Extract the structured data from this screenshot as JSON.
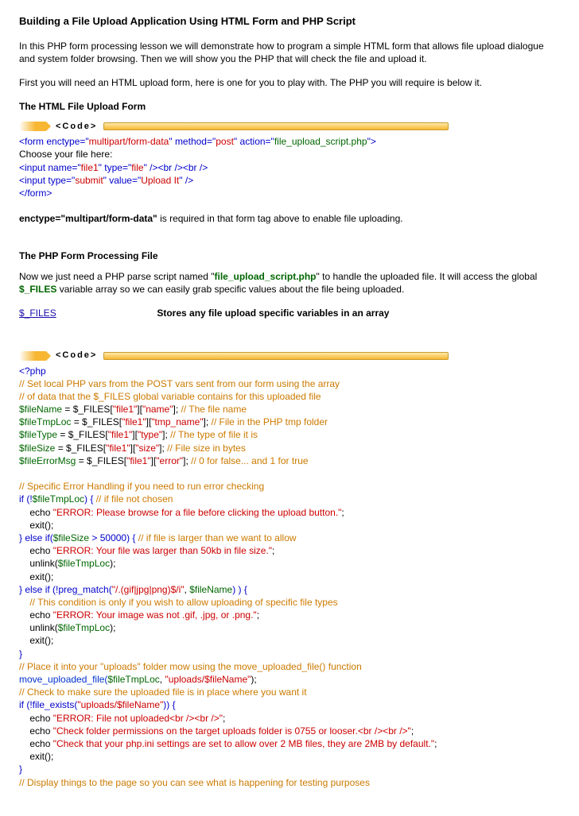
{
  "title": "Building a File Upload Application Using HTML Form and PHP Script",
  "intro1": "In this PHP form processing lesson we will demonstrate how to program a simple HTML form that allows file upload dialogue and system folder browsing. Then we will show you the PHP that will check the file and upload it.",
  "intro2": "First you will need an HTML upload form, here is one for you to play with. The PHP you will require is below it.",
  "h_html_form": "The HTML File Upload Form",
  "banner_label": "<Code>",
  "html_code": {
    "l1a": "<form enctype=\"",
    "l1b": "multipart/form-data",
    "l1c": "\" method=\"",
    "l1d": "post",
    "l1e": "\" action=\"",
    "l1f": "file_upload_script.php",
    "l1g": "\">",
    "l2": "Choose your file here:",
    "l3a": "<input name=\"",
    "l3b": "file1",
    "l3c": "\" type=\"",
    "l3d": "file",
    "l3e": "\" /><br /><br />",
    "l4a": "<input type=\"",
    "l4b": "submit",
    "l4c": "\" value=\"",
    "l4d": "Upload It",
    "l4e": "\" />",
    "l5": "</form>"
  },
  "enctype_note_prefix": "enctype=\"multipart/form-data\"",
  "enctype_note_rest": " is required in that form tag above to enable file uploading.",
  "h_php_file": "The PHP Form Processing File",
  "php_intro_a": "Now we just need a PHP parse script named \"",
  "php_intro_b": "file_upload_script.php",
  "php_intro_c": "\" to handle the uploaded file. It will access the global ",
  "php_intro_var": "$_FILES",
  "php_intro_d": " variable array so we can easily grab specific values about the file being uploaded.",
  "files_link": "$_FILES",
  "files_desc": "Stores any file upload specific variables in an array",
  "php_code": {
    "p01": "<?php",
    "p02": "// Set local PHP vars from the POST vars sent from our form using the array",
    "p03": "// of data that the $_FILES global variable contains for this uploaded file",
    "p04_var": "$fileName",
    "p04_mid": " = $_FILES[",
    "p04_k1": "\"file1\"",
    "p04_b": "][",
    "p04_k2": "\"name\"",
    "p04_end": "];",
    "p04_c": " // The file name",
    "p05_var": "$fileTmpLoc",
    "p05_k2": "\"tmp_name\"",
    "p05_c": " // File in the PHP tmp folder",
    "p06_var": "$fileType",
    "p06_k2": "\"type\"",
    "p06_c": " // The type of file it is",
    "p07_var": "$fileSize",
    "p07_k2": "\"size\"",
    "p07_c": " // File size in bytes",
    "p08_var": "$fileErrorMsg",
    "p08_k2": "\"error\"",
    "p08_c": " // 0 for false... and 1 for true",
    "p10": "// Specific Error Handling if you need to run error checking",
    "p11a": "if (!",
    "p11v": "$fileTmpLoc",
    "p11b": ") {",
    "p11c": " // if file not chosen",
    "p12a": "    echo ",
    "p12s": "\"ERROR: Please browse for a file before clicking the upload button.\"",
    "p12b": ";",
    "p13": "    exit();",
    "p14a": "} else if(",
    "p14v": "$fileSize",
    "p14b": " > 50000) {",
    "p14c": " // if file is larger than we want to allow",
    "p15s": "\"ERROR: Your file was larger than 50kb in file size.\"",
    "p16a": "    unlink(",
    "p16v": "$fileTmpLoc",
    "p16b": ");",
    "p18a": "} else if (!preg_match(",
    "p18s": "\"/.(gif|jpg|png)$/i\"",
    "p18b": ", ",
    "p18v": "$fileName",
    "p18c": ") ) {",
    "p19": "    // This condition is only if you wish to allow uploading of specific file types",
    "p20s": "\"ERROR: Your image was not .gif, .jpg, or .png.\"",
    "p23": "}",
    "p24": "// Place it into your \"uploads\" folder mow using the move_uploaded_file() function",
    "p25a": "move_uploaded_file(",
    "p25v": "$fileTmpLoc",
    "p25b": ", ",
    "p25s": "\"uploads/$fileName\"",
    "p25c": ");",
    "p26": "// Check to make sure the uploaded file is in place where you want it",
    "p27a": "if (!file_exists(",
    "p27s": "\"uploads/$fileName\"",
    "p27b": ")) {",
    "p28s": "\"ERROR: File not uploaded<br /><br />\"",
    "p29s": "\"Check folder permissions on the target uploads folder is 0755 or looser.<br /><br />\"",
    "p30s": "\"Check that your php.ini settings are set to allow over 2 MB files, they are 2MB by default.\"",
    "p33": "// Display things to the page so you can see what is happening for testing purposes"
  }
}
